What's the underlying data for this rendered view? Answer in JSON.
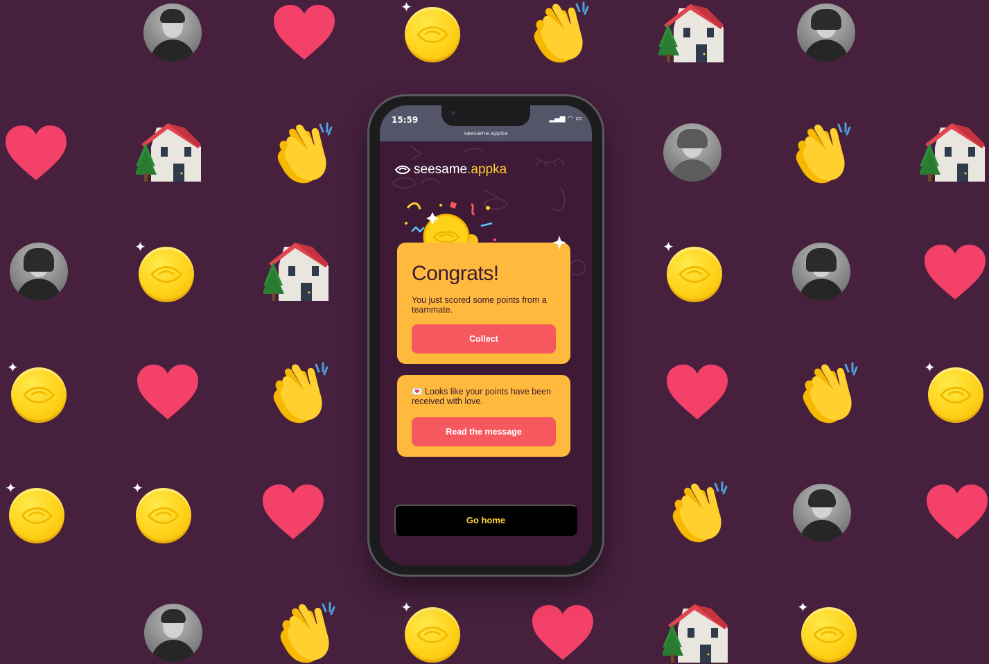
{
  "colors": {
    "background": "#46203d",
    "screen_background": "#3e1a37",
    "card": "#ffb93d",
    "button": "#f5585f",
    "home_button": "#000000",
    "home_button_text": "#ffd43a",
    "brand_accent": "#ffcc2e"
  },
  "status_bar": {
    "time": "15:59",
    "url": "seesame.appka"
  },
  "brand": {
    "name_part1": "seesame",
    "name_part2": ".appka"
  },
  "congrats_card": {
    "title": "Congrats!",
    "text": "You just scored some points from a teammate.",
    "button_label": "Collect"
  },
  "message_card": {
    "icon": "love-letter-icon",
    "text": "💌 Looks like your points have been received with love.",
    "button_label": "Read the message"
  },
  "home_button": {
    "label": "Go home"
  },
  "background_icons": [
    "heart-icon",
    "coin-icon",
    "clapping-hands-icon",
    "house-icon",
    "avatar"
  ]
}
